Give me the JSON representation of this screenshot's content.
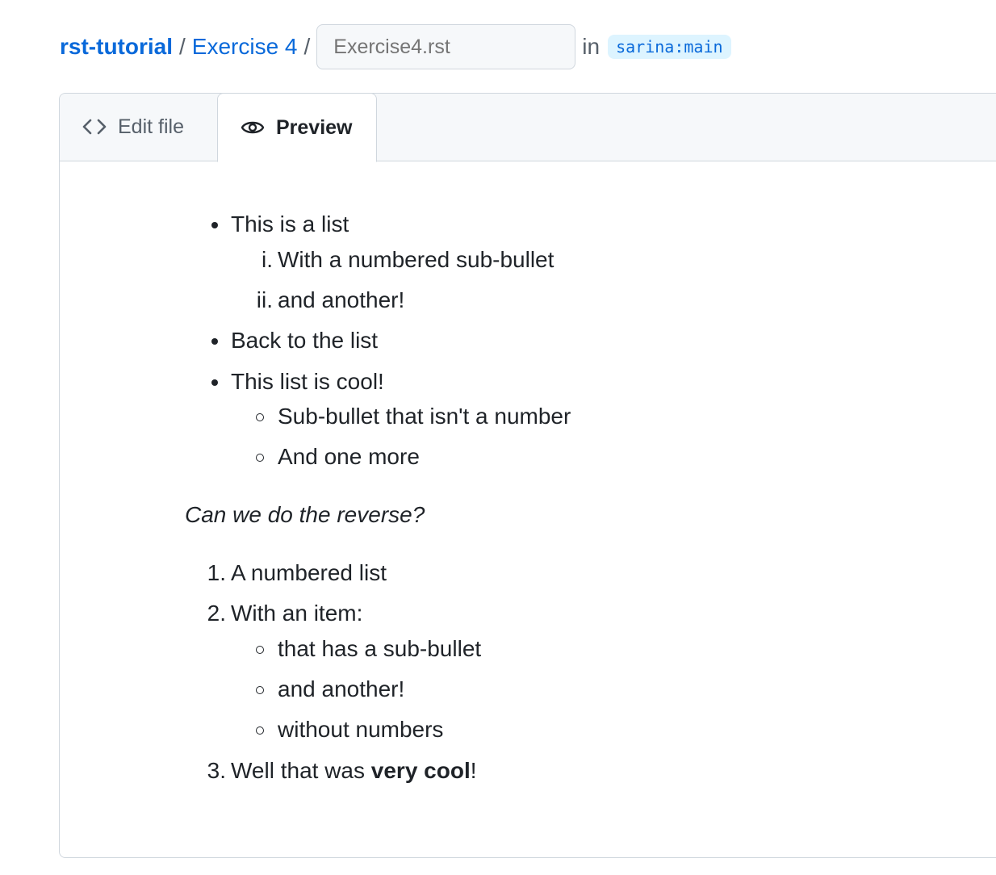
{
  "breadcrumb": {
    "repo": "rst-tutorial",
    "separator": "/",
    "folder": "Exercise 4",
    "filename_placeholder": "Exercise4.rst",
    "in_word": "in",
    "branch": "sarina:main"
  },
  "tabs": {
    "edit": {
      "label": "Edit file",
      "icon": "code-icon"
    },
    "preview": {
      "label": "Preview",
      "icon": "eye-icon",
      "selected": true
    }
  },
  "preview": {
    "bullet_list": [
      {
        "text": "This is a list",
        "roman_sub": [
          {
            "marker": "i.",
            "text": "With a numbered sub-bullet"
          },
          {
            "marker": "ii.",
            "text": "and another!"
          }
        ]
      },
      {
        "text": "Back to the list"
      },
      {
        "text": "This list is cool!",
        "circle_sub": [
          "Sub-bullet that isn't a number",
          "And one more"
        ]
      }
    ],
    "italic_question": "Can we do the reverse?",
    "numbered_list": [
      {
        "marker": "1.",
        "text": "A numbered list"
      },
      {
        "marker": "2.",
        "text": "With an item:",
        "circle_sub": [
          "that has a sub-bullet",
          "and another!",
          "without numbers"
        ]
      },
      {
        "marker": "3.",
        "text_before": "Well that was ",
        "text_bold": "very cool",
        "text_after": "!"
      }
    ]
  }
}
